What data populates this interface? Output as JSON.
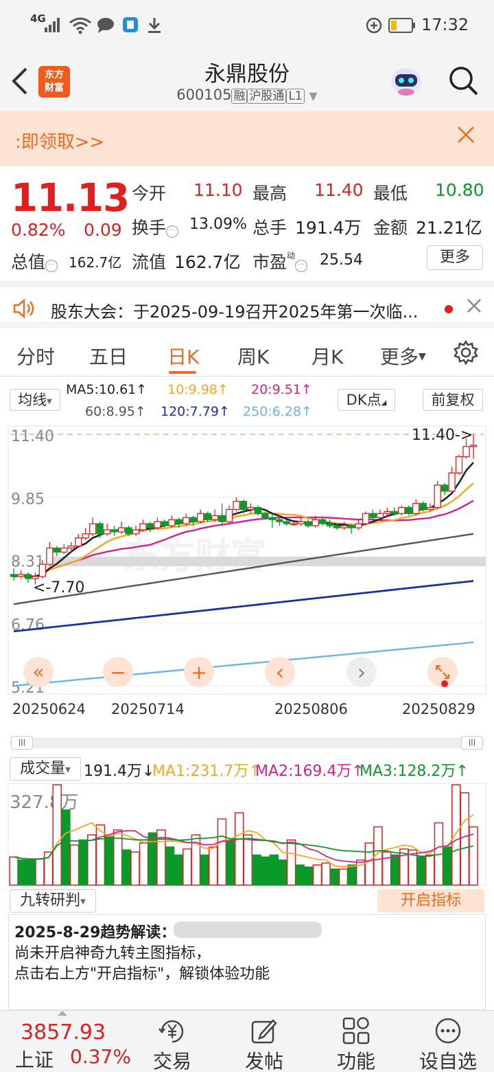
{
  "status_bar": {
    "network": "4G",
    "time": "17:32"
  },
  "header": {
    "logo_text_1": "东方",
    "logo_text_2": "财富",
    "stock_name": "永鼎股份",
    "stock_code": "600105",
    "tag_margin": "融",
    "tag_connect": "沪股通",
    "tag_level": "L1"
  },
  "promo": {
    "text": ":即领取>>"
  },
  "quote": {
    "price": "11.13",
    "change_pct": "0.82%",
    "change": "0.09",
    "open_label": "今开",
    "open": "11.10",
    "high_label": "最高",
    "high": "11.40",
    "low_label": "最低",
    "low": "10.80",
    "turnover_label": "换手",
    "turnover": "13.09%",
    "volume_label": "总手",
    "volume": "191.4万",
    "amount_label": "金额",
    "amount": "21.21亿",
    "total_cap_label": "总值",
    "total_cap": "162.7亿",
    "float_cap_label": "流值",
    "float_cap": "162.7亿",
    "pe_label": "市盈",
    "pe_sup": "动",
    "pe": "25.54",
    "more": "更多"
  },
  "notice": {
    "text": "股东大会：于2025-09-19召开2025年第一次临..."
  },
  "tabs": [
    "分时",
    "五日",
    "日K",
    "周K",
    "月K",
    "更多"
  ],
  "active_tab": "日K",
  "ma_legend": {
    "selector": "均线",
    "ma5": "MA5:10.61↑",
    "ma10": "10:9.98↑",
    "ma20": "20:9.51↑",
    "ma60": "60:8.95↑",
    "ma120": "120:7.79↑",
    "ma250": "250:6.28↑",
    "dk": "DK点",
    "adjust": "前复权"
  },
  "colors": {
    "up": "#e02020",
    "down": "#0a9a2a",
    "ma5": "#222222",
    "ma10": "#f5a623",
    "ma20": "#d4218f",
    "ma60": "#555555",
    "ma120": "#1a2fa8",
    "ma250": "#6ab4ea",
    "accent": "#ef6b22"
  },
  "chart_data": {
    "type": "candlestick",
    "y_axis_labels": [
      "11.40",
      "9.85",
      "8.31",
      "6.76",
      "5.21"
    ],
    "ylim": [
      5.21,
      11.4
    ],
    "x_labels": [
      "20250624",
      "20250714",
      "20250806",
      "20250829"
    ],
    "annotations": {
      "high": "11.40->",
      "low": "<-7.70"
    },
    "candles": [
      [
        7.95,
        7.9,
        8.1,
        7.8
      ],
      [
        7.9,
        7.95,
        8.05,
        7.85
      ],
      [
        7.95,
        7.85,
        8.0,
        7.75
      ],
      [
        7.85,
        7.9,
        8.0,
        7.7
      ],
      [
        7.9,
        8.2,
        8.3,
        7.85
      ],
      [
        8.2,
        8.6,
        8.75,
        8.15
      ],
      [
        8.6,
        8.5,
        8.65,
        8.4
      ],
      [
        8.5,
        8.6,
        8.7,
        8.45
      ],
      [
        8.6,
        8.65,
        8.75,
        8.5
      ],
      [
        8.65,
        8.85,
        8.95,
        8.6
      ],
      [
        8.85,
        8.95,
        9.1,
        8.8
      ],
      [
        8.95,
        9.2,
        9.35,
        8.9
      ],
      [
        9.2,
        8.95,
        9.25,
        8.85
      ],
      [
        8.95,
        9.05,
        9.2,
        8.9
      ],
      [
        9.05,
        9.0,
        9.15,
        8.9
      ],
      [
        9.0,
        9.1,
        9.25,
        8.95
      ],
      [
        9.1,
        8.95,
        9.15,
        8.9
      ],
      [
        8.95,
        9.05,
        9.15,
        8.9
      ],
      [
        9.05,
        9.2,
        9.3,
        9.0
      ],
      [
        9.2,
        9.1,
        9.25,
        9.0
      ],
      [
        9.1,
        9.25,
        9.35,
        9.05
      ],
      [
        9.25,
        9.15,
        9.3,
        9.1
      ],
      [
        9.15,
        9.3,
        9.4,
        9.1
      ],
      [
        9.3,
        9.2,
        9.35,
        9.1
      ],
      [
        9.2,
        9.35,
        9.45,
        9.15
      ],
      [
        9.35,
        9.25,
        9.4,
        9.15
      ],
      [
        9.25,
        9.45,
        9.55,
        9.2
      ],
      [
        9.45,
        9.3,
        9.5,
        9.25
      ],
      [
        9.3,
        9.4,
        9.55,
        9.25
      ],
      [
        9.4,
        9.25,
        9.7,
        9.15
      ],
      [
        9.25,
        9.55,
        9.65,
        9.2
      ],
      [
        9.55,
        9.75,
        9.85,
        9.5
      ],
      [
        9.75,
        9.55,
        9.8,
        9.45
      ],
      [
        9.55,
        9.6,
        9.7,
        9.45
      ],
      [
        9.6,
        9.45,
        9.65,
        9.4
      ],
      [
        9.45,
        9.35,
        9.5,
        9.3
      ],
      [
        9.35,
        9.3,
        9.45,
        9.1
      ],
      [
        9.3,
        9.25,
        9.4,
        9.15
      ],
      [
        9.25,
        9.2,
        9.3,
        9.15
      ],
      [
        9.2,
        9.2,
        9.25,
        9.15
      ],
      [
        9.2,
        9.25,
        9.35,
        9.15
      ],
      [
        9.25,
        9.15,
        9.3,
        9.1
      ],
      [
        9.15,
        9.3,
        9.4,
        9.1
      ],
      [
        9.3,
        9.2,
        9.35,
        9.15
      ],
      [
        9.2,
        9.15,
        9.3,
        9.1
      ],
      [
        9.15,
        9.1,
        9.2,
        9.05
      ],
      [
        9.1,
        9.15,
        9.25,
        9.05
      ],
      [
        9.15,
        9.1,
        9.2,
        8.95
      ],
      [
        9.1,
        9.2,
        9.3,
        9.05
      ],
      [
        9.2,
        9.45,
        9.5,
        9.15
      ],
      [
        9.45,
        9.35,
        9.55,
        9.3
      ],
      [
        9.35,
        9.45,
        9.55,
        9.3
      ],
      [
        9.45,
        9.5,
        9.6,
        9.35
      ],
      [
        9.5,
        9.45,
        9.6,
        9.4
      ],
      [
        9.45,
        9.6,
        9.65,
        9.4
      ],
      [
        9.6,
        9.45,
        9.65,
        9.4
      ],
      [
        9.45,
        9.7,
        9.8,
        9.4
      ],
      [
        9.7,
        9.55,
        9.75,
        9.5
      ],
      [
        9.55,
        9.6,
        9.7,
        9.5
      ],
      [
        9.6,
        10.15,
        10.25,
        9.55
      ],
      [
        10.15,
        10.0,
        10.2,
        9.9
      ],
      [
        10.0,
        10.45,
        10.6,
        9.95
      ],
      [
        10.45,
        10.85,
        10.9,
        10.4
      ],
      [
        10.85,
        11.1,
        11.3,
        10.8
      ],
      [
        11.1,
        11.13,
        11.4,
        10.8
      ]
    ]
  },
  "chart_nav": {
    "fast_back": "«",
    "zoom_out": "−",
    "zoom_in": "+",
    "prev": "‹",
    "next": "›"
  },
  "volume": {
    "selector": "成交量",
    "value": "191.4万↓",
    "ma1": "MA1:231.7万↑",
    "ma2": "MA2:169.4万↑",
    "ma3": "MA3:128.2万↑",
    "max_label": "327.8万",
    "bars": [
      [
        0.28,
        "u"
      ],
      [
        0.25,
        "d"
      ],
      [
        0.25,
        "d"
      ],
      [
        0.26,
        "u"
      ],
      [
        0.33,
        "u"
      ],
      [
        1.0,
        "u"
      ],
      [
        0.75,
        "d"
      ],
      [
        0.4,
        "u"
      ],
      [
        0.45,
        "d"
      ],
      [
        0.5,
        "u"
      ],
      [
        0.6,
        "u"
      ],
      [
        0.48,
        "d"
      ],
      [
        0.55,
        "u"
      ],
      [
        0.35,
        "d"
      ],
      [
        0.33,
        "u"
      ],
      [
        0.42,
        "u"
      ],
      [
        0.52,
        "d"
      ],
      [
        0.55,
        "u"
      ],
      [
        0.38,
        "d"
      ],
      [
        0.3,
        "d"
      ],
      [
        0.36,
        "u"
      ],
      [
        0.5,
        "u"
      ],
      [
        0.3,
        "d"
      ],
      [
        0.38,
        "u"
      ],
      [
        0.66,
        "u"
      ],
      [
        0.45,
        "d"
      ],
      [
        0.72,
        "u"
      ],
      [
        0.5,
        "u"
      ],
      [
        0.3,
        "d"
      ],
      [
        0.28,
        "d"
      ],
      [
        0.3,
        "d"
      ],
      [
        0.25,
        "d"
      ],
      [
        0.45,
        "u"
      ],
      [
        0.2,
        "d"
      ],
      [
        0.18,
        "d"
      ],
      [
        0.2,
        "u"
      ],
      [
        0.22,
        "u"
      ],
      [
        0.16,
        "d"
      ],
      [
        0.16,
        "u"
      ],
      [
        0.2,
        "d"
      ],
      [
        0.25,
        "u"
      ],
      [
        0.42,
        "u"
      ],
      [
        0.58,
        "u"
      ],
      [
        0.33,
        "u"
      ],
      [
        0.3,
        "d"
      ],
      [
        0.36,
        "u"
      ],
      [
        0.35,
        "u"
      ],
      [
        0.28,
        "d"
      ],
      [
        0.3,
        "u"
      ],
      [
        0.62,
        "u"
      ],
      [
        0.38,
        "d"
      ],
      [
        1.0,
        "u"
      ],
      [
        0.92,
        "u"
      ],
      [
        0.58,
        "u"
      ]
    ]
  },
  "indicator": {
    "selector": "九转研判",
    "enable": "开启指标"
  },
  "analysis": {
    "title": "2025-8-29趋势解读：",
    "line1": "尚未开启神奇九转主图指标，",
    "line2": "点击右上方\"开启指标\"，解锁体验功能"
  },
  "bottom_nav": {
    "index_value": "3857.93",
    "index_name": "上证",
    "index_pct": "0.37%",
    "items": [
      "交易",
      "发帖",
      "功能",
      "设自选"
    ]
  }
}
